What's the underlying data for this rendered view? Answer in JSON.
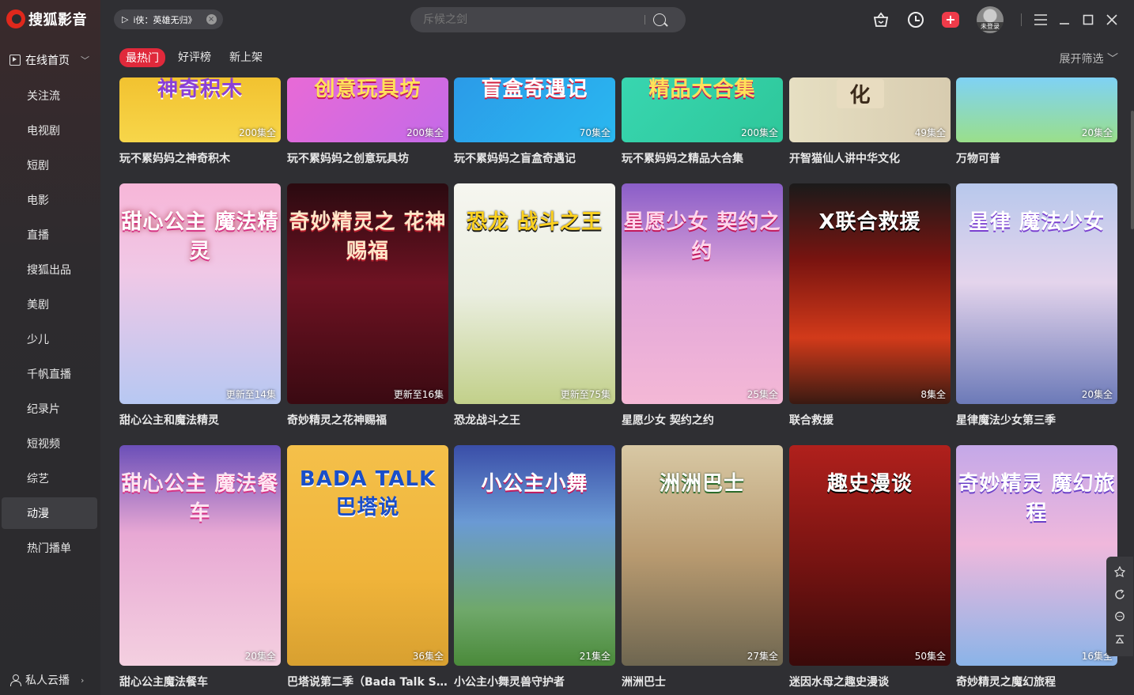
{
  "app": {
    "title": "搜狐影音"
  },
  "now_playing": {
    "label": "i侠：英雄无归》"
  },
  "search": {
    "placeholder": "斥候之剑"
  },
  "account": {
    "avatar_label": "未登录"
  },
  "sidebar": {
    "home": "在线首页",
    "items": [
      "关注流",
      "电视剧",
      "短剧",
      "电影",
      "直播",
      "搜狐出品",
      "美剧",
      "少儿",
      "千帆直播",
      "纪录片",
      "短视频",
      "综艺",
      "动漫",
      "热门播单"
    ],
    "active_item": "动漫",
    "cloud": "私人云播"
  },
  "filters": {
    "tabs": [
      "最热门",
      "好评榜",
      "新上架"
    ],
    "active": "最热门",
    "expand": "展开筛选"
  },
  "rows": [
    [
      {
        "title": "玩不累妈妈之神奇积木",
        "badge": "200集全",
        "poster_text": "神奇积木"
      },
      {
        "title": "玩不累妈妈之创意玩具坊",
        "badge": "200集全",
        "poster_text": "创意玩具坊"
      },
      {
        "title": "玩不累妈妈之盲盒奇遇记",
        "badge": "70集全",
        "poster_text": "盲盒奇遇记"
      },
      {
        "title": "玩不累妈妈之精品大合集",
        "badge": "200集全",
        "poster_text": "精品大合集"
      },
      {
        "title": "开智猫仙人讲中华文化",
        "badge": "49集全",
        "poster_text": "化"
      },
      {
        "title": "万物可普",
        "badge": "20集全",
        "poster_text": ""
      }
    ],
    [
      {
        "title": "甜心公主和魔法精灵",
        "badge": "更新至14集",
        "poster_text": "甜心公主 魔法精灵"
      },
      {
        "title": "奇妙精灵之花神赐福",
        "badge": "更新至16集",
        "poster_text": "奇妙精灵之 花神赐福"
      },
      {
        "title": "恐龙战斗之王",
        "badge": "更新至75集",
        "poster_text": "恐龙 战斗之王"
      },
      {
        "title": "星愿少女 契约之约",
        "badge": "25集全",
        "poster_text": "星愿少女 契约之约"
      },
      {
        "title": "联合救援",
        "badge": "8集全",
        "poster_text": "X联合救援"
      },
      {
        "title": "星律魔法少女第三季",
        "badge": "20集全",
        "poster_text": "星律 魔法少女"
      }
    ],
    [
      {
        "title": "甜心公主魔法餐车",
        "badge": "20集全",
        "poster_text": "甜心公主 魔法餐车"
      },
      {
        "title": "巴塔说第二季（Bada Talk S2...",
        "badge": "36集全",
        "poster_text": "BADA TALK 巴塔说"
      },
      {
        "title": "小公主小舞灵兽守护者",
        "badge": "21集全",
        "poster_text": "小公主小舞"
      },
      {
        "title": "洲洲巴士",
        "badge": "27集全",
        "poster_text": "洲洲巴士"
      },
      {
        "title": "迷因水母之趣史漫谈",
        "badge": "50集全",
        "poster_text": "趣史漫谈"
      },
      {
        "title": "奇妙精灵之魔幻旅程",
        "badge": "16集全",
        "poster_text": "奇妙精灵 魔幻旅程"
      }
    ]
  ],
  "colors": {
    "accent": "#e0293b",
    "bg": "#2f2f33",
    "sidebar": "#2b2b2e"
  }
}
